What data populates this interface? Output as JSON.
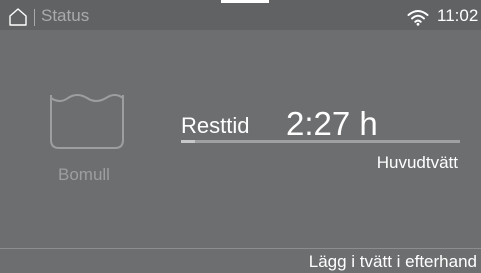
{
  "statusbar": {
    "title": "Status",
    "time": "11:02",
    "home_icon": "home-icon",
    "wifi_icon": "wifi-icon"
  },
  "program": {
    "name": "Bomull",
    "icon": "wash-tub-icon"
  },
  "remaining": {
    "label": "Resttid",
    "time": "2:27 h",
    "phase": "Huvudtvätt",
    "progress_fraction": 0.05
  },
  "footer": {
    "action_label": "Lägg i tvätt i efterhand"
  },
  "colors": {
    "background": "#6d6e70",
    "statusbar": "#616264",
    "text": "#ffffff",
    "muted_text": "#9d9ea0"
  }
}
